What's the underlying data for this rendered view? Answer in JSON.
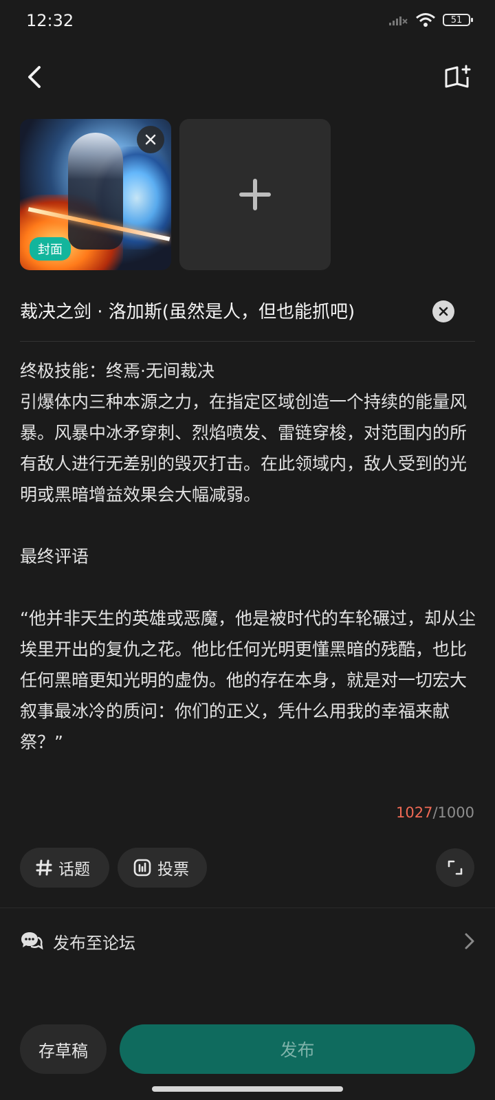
{
  "status_bar": {
    "time": "12:32",
    "battery": "51"
  },
  "images": {
    "cover_tag": "封面"
  },
  "title": "裁决之剑 · 洛加斯(虽然是人，但也能抓吧)",
  "body_text": "终极技能：终焉·无间裁决\n引爆体内三种本源之力，在指定区域创造一个持续的能量风暴。风暴中冰矛穿刺、烈焰喷发、雷链穿梭，对范围内的所有敌人进行无差别的毁灭打击。在此领域内，敌人受到的光明或黑暗增益效果会大幅减弱。\n\n最终评语\n\n“他并非天生的英雄或恶魔，他是被时代的车轮碾过，却从尘埃里开出的复仇之花。他比任何光明更懂黑暗的残酷，也比任何黑暗更知光明的虚伪。他的存在本身，就是对一切宏大叙事最冰冷的质问：你们的正义，凭什么用我的幸福来献祭？”",
  "counter": {
    "current": "1027",
    "max": "/1000"
  },
  "toolbar": {
    "topic_label": "话题",
    "vote_label": "投票"
  },
  "forum": {
    "label": "发布至论坛"
  },
  "actions": {
    "draft_label": "存草稿",
    "publish_label": "发布"
  },
  "colors": {
    "accent": "#13b59c",
    "publish_bg": "#0f6b5e",
    "over_limit": "#f06a55"
  },
  "icons": [
    "back-icon",
    "book-add-icon",
    "close-icon",
    "plus-icon",
    "clear-icon",
    "hashtag-icon",
    "vote-icon",
    "expand-icon",
    "forum-chat-icon",
    "chevron-right-icon"
  ]
}
